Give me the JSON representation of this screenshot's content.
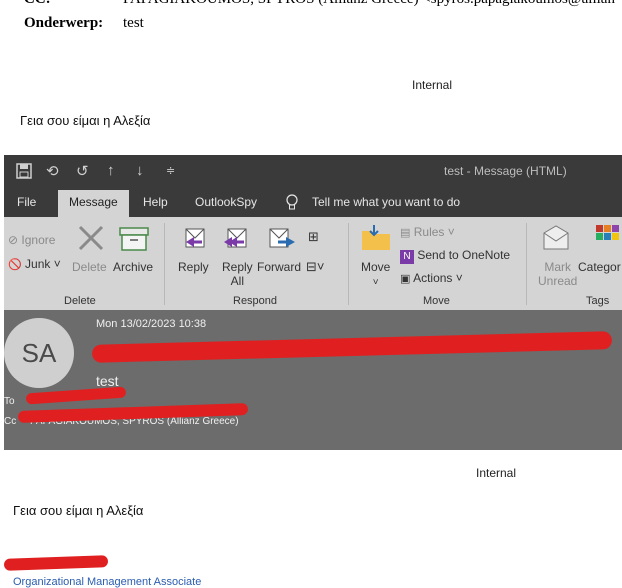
{
  "top_email": {
    "cc_label": "CC:",
    "cc_value": "PAPAGIAKOUMOS, SPYROS (Allianz Greece) <spyros.papagiakoumos@allian",
    "subject_label": "Onderwerp:",
    "subject_value": "test",
    "classification": "Internal",
    "body": "Γεια σου είμαι η Αλεξία"
  },
  "window": {
    "title": "test  -  Message (HTML)",
    "tabs": [
      "File",
      "Message",
      "Help",
      "OutlookSpy"
    ],
    "active_tab": "Message",
    "tell_me": "Tell me what you want to do"
  },
  "ribbon": {
    "delete_group": {
      "label": "Delete",
      "ignore": "Ignore",
      "junk": "Junk ˅",
      "delete": "Delete",
      "archive": "Archive"
    },
    "respond_group": {
      "label": "Respond",
      "reply": "Reply",
      "reply_all_1": "Reply",
      "reply_all_2": "All",
      "forward": "Forward"
    },
    "move_group": {
      "label": "Move",
      "move": "Move",
      "rules": "Rules ˅",
      "send_onenote": "Send to OneNote",
      "actions": "Actions ˅"
    },
    "tags_group": {
      "label": "Tags",
      "mark_unread_1": "Mark",
      "mark_unread_2": "Unread",
      "categorize": "Categor"
    }
  },
  "message": {
    "date": "Mon 13/02/2023 10:38",
    "avatar_initials": "SA",
    "subject": "test",
    "to_label": "To",
    "cc_label": "Cc",
    "cc_value": "PAPAGIAKOUMOS, SPYROS (Allianz Greece)"
  },
  "lower_email": {
    "classification": "Internal",
    "body": "Γεια σου είμαι η Αλεξία",
    "signature_title": "Organizational Management Associate"
  }
}
